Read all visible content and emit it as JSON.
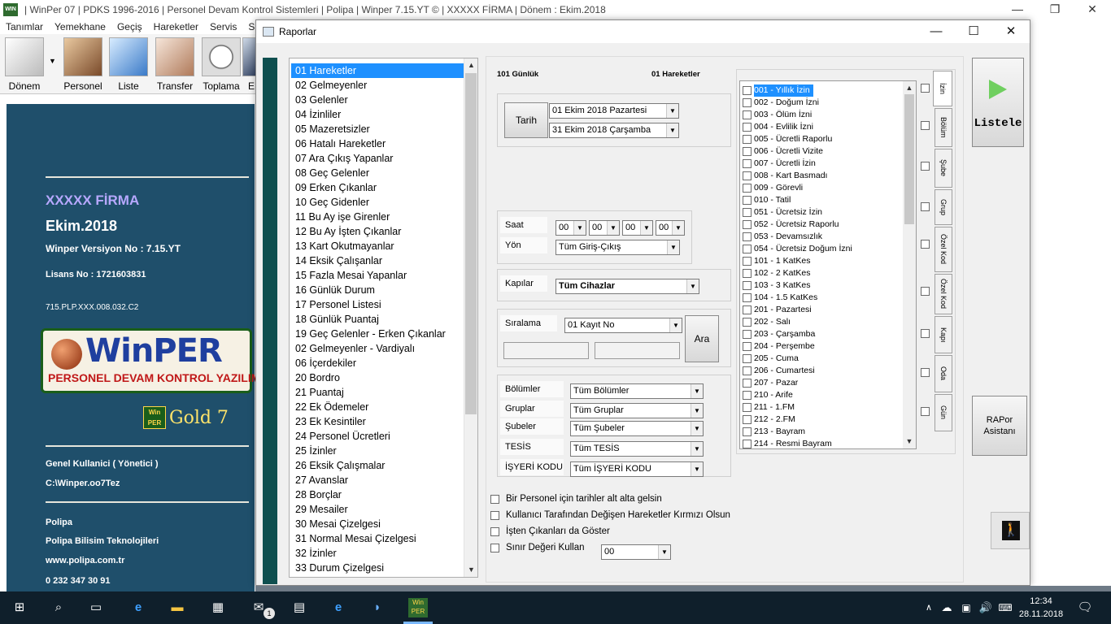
{
  "app": {
    "title": "| WinPer 07 | PDKS 1996-2016 | Personel Devam Kontrol Sistemleri | Polipa | Winper 7.15.YT © | XXXXX FİRMA | Dönem : Ekim.2018",
    "menu": [
      "Tanımlar",
      "Yemekhane",
      "Geçiş",
      "Hareketler",
      "Servis",
      "Sis"
    ],
    "toolbar": [
      "Dönem",
      "Personel",
      "Liste",
      "Transfer",
      "Toplama",
      "E"
    ]
  },
  "sidebar": {
    "firm": "XXXXX FİRMA",
    "period": "Ekim.2018",
    "version": "Winper Versiyon No : 7.15.YT",
    "license": "Lisans No : 1721603831",
    "code": "715.PLP.XXX.008.032.C2",
    "logo_big": "WinPER",
    "logo_small": "PERSONEL DEVAM KONTROL YAZILIMI",
    "badge_top": "Win",
    "badge_bottom": "PER",
    "gold": "Gold 7",
    "user": "Genel Kullanici ( Yönetici )",
    "path": "C:\\Winper.oo7Tez",
    "company": "Polipa",
    "company_full": "Polipa Bilisim Teknolojileri",
    "web": "www.polipa.com.tr",
    "phone": "0 232 347 30 91"
  },
  "dialog": {
    "title": "Raporlar",
    "report_count": "101 Günlük",
    "report_selected": "01 Hareketler",
    "reports": [
      "01 Hareketler",
      "02 Gelmeyenler",
      "03 Gelenler",
      "04 İzinliler",
      "05 Mazeretsizler",
      "06 Hatalı Hareketler",
      "07 Ara Çıkış Yapanlar",
      "08 Geç Gelenler",
      "09 Erken Çıkanlar",
      "10 Geç Gidenler",
      "11 Bu Ay işe Girenler",
      "12 Bu Ay İşten Çıkanlar",
      "13 Kart Okutmayanlar",
      "14 Eksik Çalışanlar",
      "15 Fazla Mesai Yapanlar",
      "16 Günlük Durum",
      "17 Personel Listesi",
      "18 Günlük Puantaj",
      "19 Geç Gelenler - Erken Çıkanlar",
      "02 Gelmeyenler - Vardiyalı",
      "06 İçerdekiler",
      "20 Bordro",
      "21 Puantaj",
      "22 Ek Ödemeler",
      "23 Ek Kesintiler",
      "24 Personel Ücretleri",
      "25 İzinler",
      "26 Eksik Çalışmalar",
      "27 Avanslar",
      "28 Borçlar",
      "29 Mesailer",
      "30 Mesai Çizelgesi",
      "31 Normal Mesai Çizelgesi",
      "32 İzinler",
      "33 Durum Çizelgesi"
    ],
    "tarih_label": "Tarih",
    "date_start": "01    Ekim    2018  Pazartesi",
    "date_end": "31    Ekim    2018 Çarşamba",
    "saat_label": "Saat",
    "time_values": [
      "00",
      "00",
      "00",
      "00"
    ],
    "yon_label": "Yön",
    "yon_value": "Tüm Giriş-Çıkış",
    "kapilar_label": "Kapılar",
    "kapilar_value": "Tüm Cihazlar",
    "siralama_label": "Sıralama",
    "siralama_value": "01   Kayıt No",
    "ara_label": "Ara",
    "filters": [
      {
        "label": "Bölümler",
        "value": "Tüm Bölümler"
      },
      {
        "label": "Gruplar",
        "value": "Tüm Gruplar"
      },
      {
        "label": "Şubeler",
        "value": "Tüm Şubeler"
      },
      {
        "label": "TESİS",
        "value": "Tüm TESİS"
      },
      {
        "label": "İŞYERİ KODU",
        "value": "Tüm İŞYERİ KODU"
      }
    ],
    "leave_types": [
      "001 - Yıllık İzin",
      "002 - Doğum İzni",
      "003 - Ölüm İzni",
      "004 - Evlilik İzni",
      "005 - Ücretli Raporlu",
      "006 - Ücretli Vizite",
      "007 - Ücretli İzin",
      "008 - Kart Basmadı",
      "009 - Görevli",
      "010 - Tatil",
      "051 - Ücretsiz İzin",
      "052 - Ücretsiz Raporlu",
      "053 - Devamsızlık",
      "054 - Ücretsiz Doğum İzni",
      "101 - 1 KatKes",
      "102 - 2 KatKes",
      "103 - 3 KatKes",
      "104 - 1.5 KatKes",
      "201 - Pazartesi",
      "202 - Salı",
      "203 - Çarşamba",
      "204 - Perşembe",
      "205 - Cuma",
      "206 - Cumartesi",
      "207 - Pazar",
      "210 - Arife",
      "211 - 1.FM",
      "212 - 2.FM",
      "213 - Bayram",
      "214 - Resmi Bayram"
    ],
    "side_tabs": [
      "İzin",
      "Bölüm",
      "Şube",
      "Grup",
      "Özel Kod",
      "Özel Kod",
      "Kapı",
      "Oda",
      "Gün"
    ],
    "options": [
      "Bir Personel için tarihler alt alta gelsin",
      "Kullanıcı Tarafından Değişen Hareketler Kırmızı Olsun",
      "İşten Çıkanları da Göster",
      "Sınır Değeri Kullan"
    ],
    "sinir_value": "00",
    "listele_label": "Listele",
    "rapor_asistani_line1": "RAPor",
    "rapor_asistani_line2": "Asistanı"
  },
  "taskbar": {
    "time": "12:34",
    "date": "28.11.2018",
    "mail_badge": "1"
  }
}
